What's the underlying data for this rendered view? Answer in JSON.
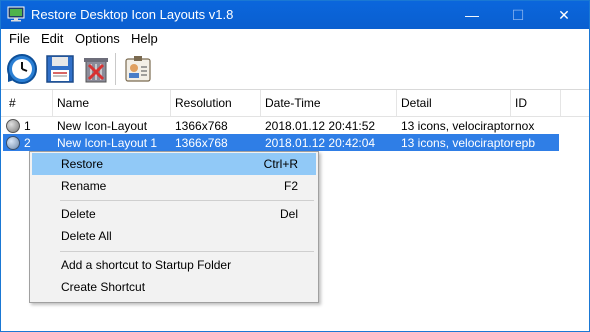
{
  "window": {
    "title": "Restore Desktop Icon Layouts v1.8",
    "minimize": "—",
    "maximize": "☐",
    "close": "✕"
  },
  "menu": [
    "File",
    "Edit",
    "Options",
    "Help"
  ],
  "toolbar": {
    "buttons": [
      "restore-clock-icon",
      "save-disk-icon",
      "delete-trash-icon",
      "id-card-icon"
    ]
  },
  "list": {
    "columns": [
      "#",
      "Name",
      "Resolution",
      "Date-Time",
      "Detail",
      "ID"
    ],
    "rows": [
      {
        "num": "1",
        "name": "New Icon-Layout",
        "resolution": "1366x768",
        "datetime": "2018.01.12 20:41:52",
        "detail": "13 icons, velociraptor",
        "id": "nox",
        "selected": false
      },
      {
        "num": "2",
        "name": "New Icon-Layout 1",
        "resolution": "1366x768",
        "datetime": "2018.01.12 20:42:04",
        "detail": "13 icons, velociraptor",
        "id": "epb",
        "selected": true
      }
    ]
  },
  "context_menu": {
    "items": [
      {
        "label": "Restore",
        "shortcut": "Ctrl+R",
        "highlighted": true
      },
      {
        "label": "Rename",
        "shortcut": "F2"
      },
      {
        "label": "Delete",
        "shortcut": "Del"
      },
      {
        "label": "Delete All",
        "shortcut": ""
      },
      {
        "label": "Add a shortcut to Startup Folder",
        "shortcut": ""
      },
      {
        "label": "Create Shortcut",
        "shortcut": ""
      }
    ]
  },
  "colors": {
    "titlebar": "#0a64d8",
    "selection": "#2f7ee6",
    "menu_highlight": "#91c9f7"
  }
}
